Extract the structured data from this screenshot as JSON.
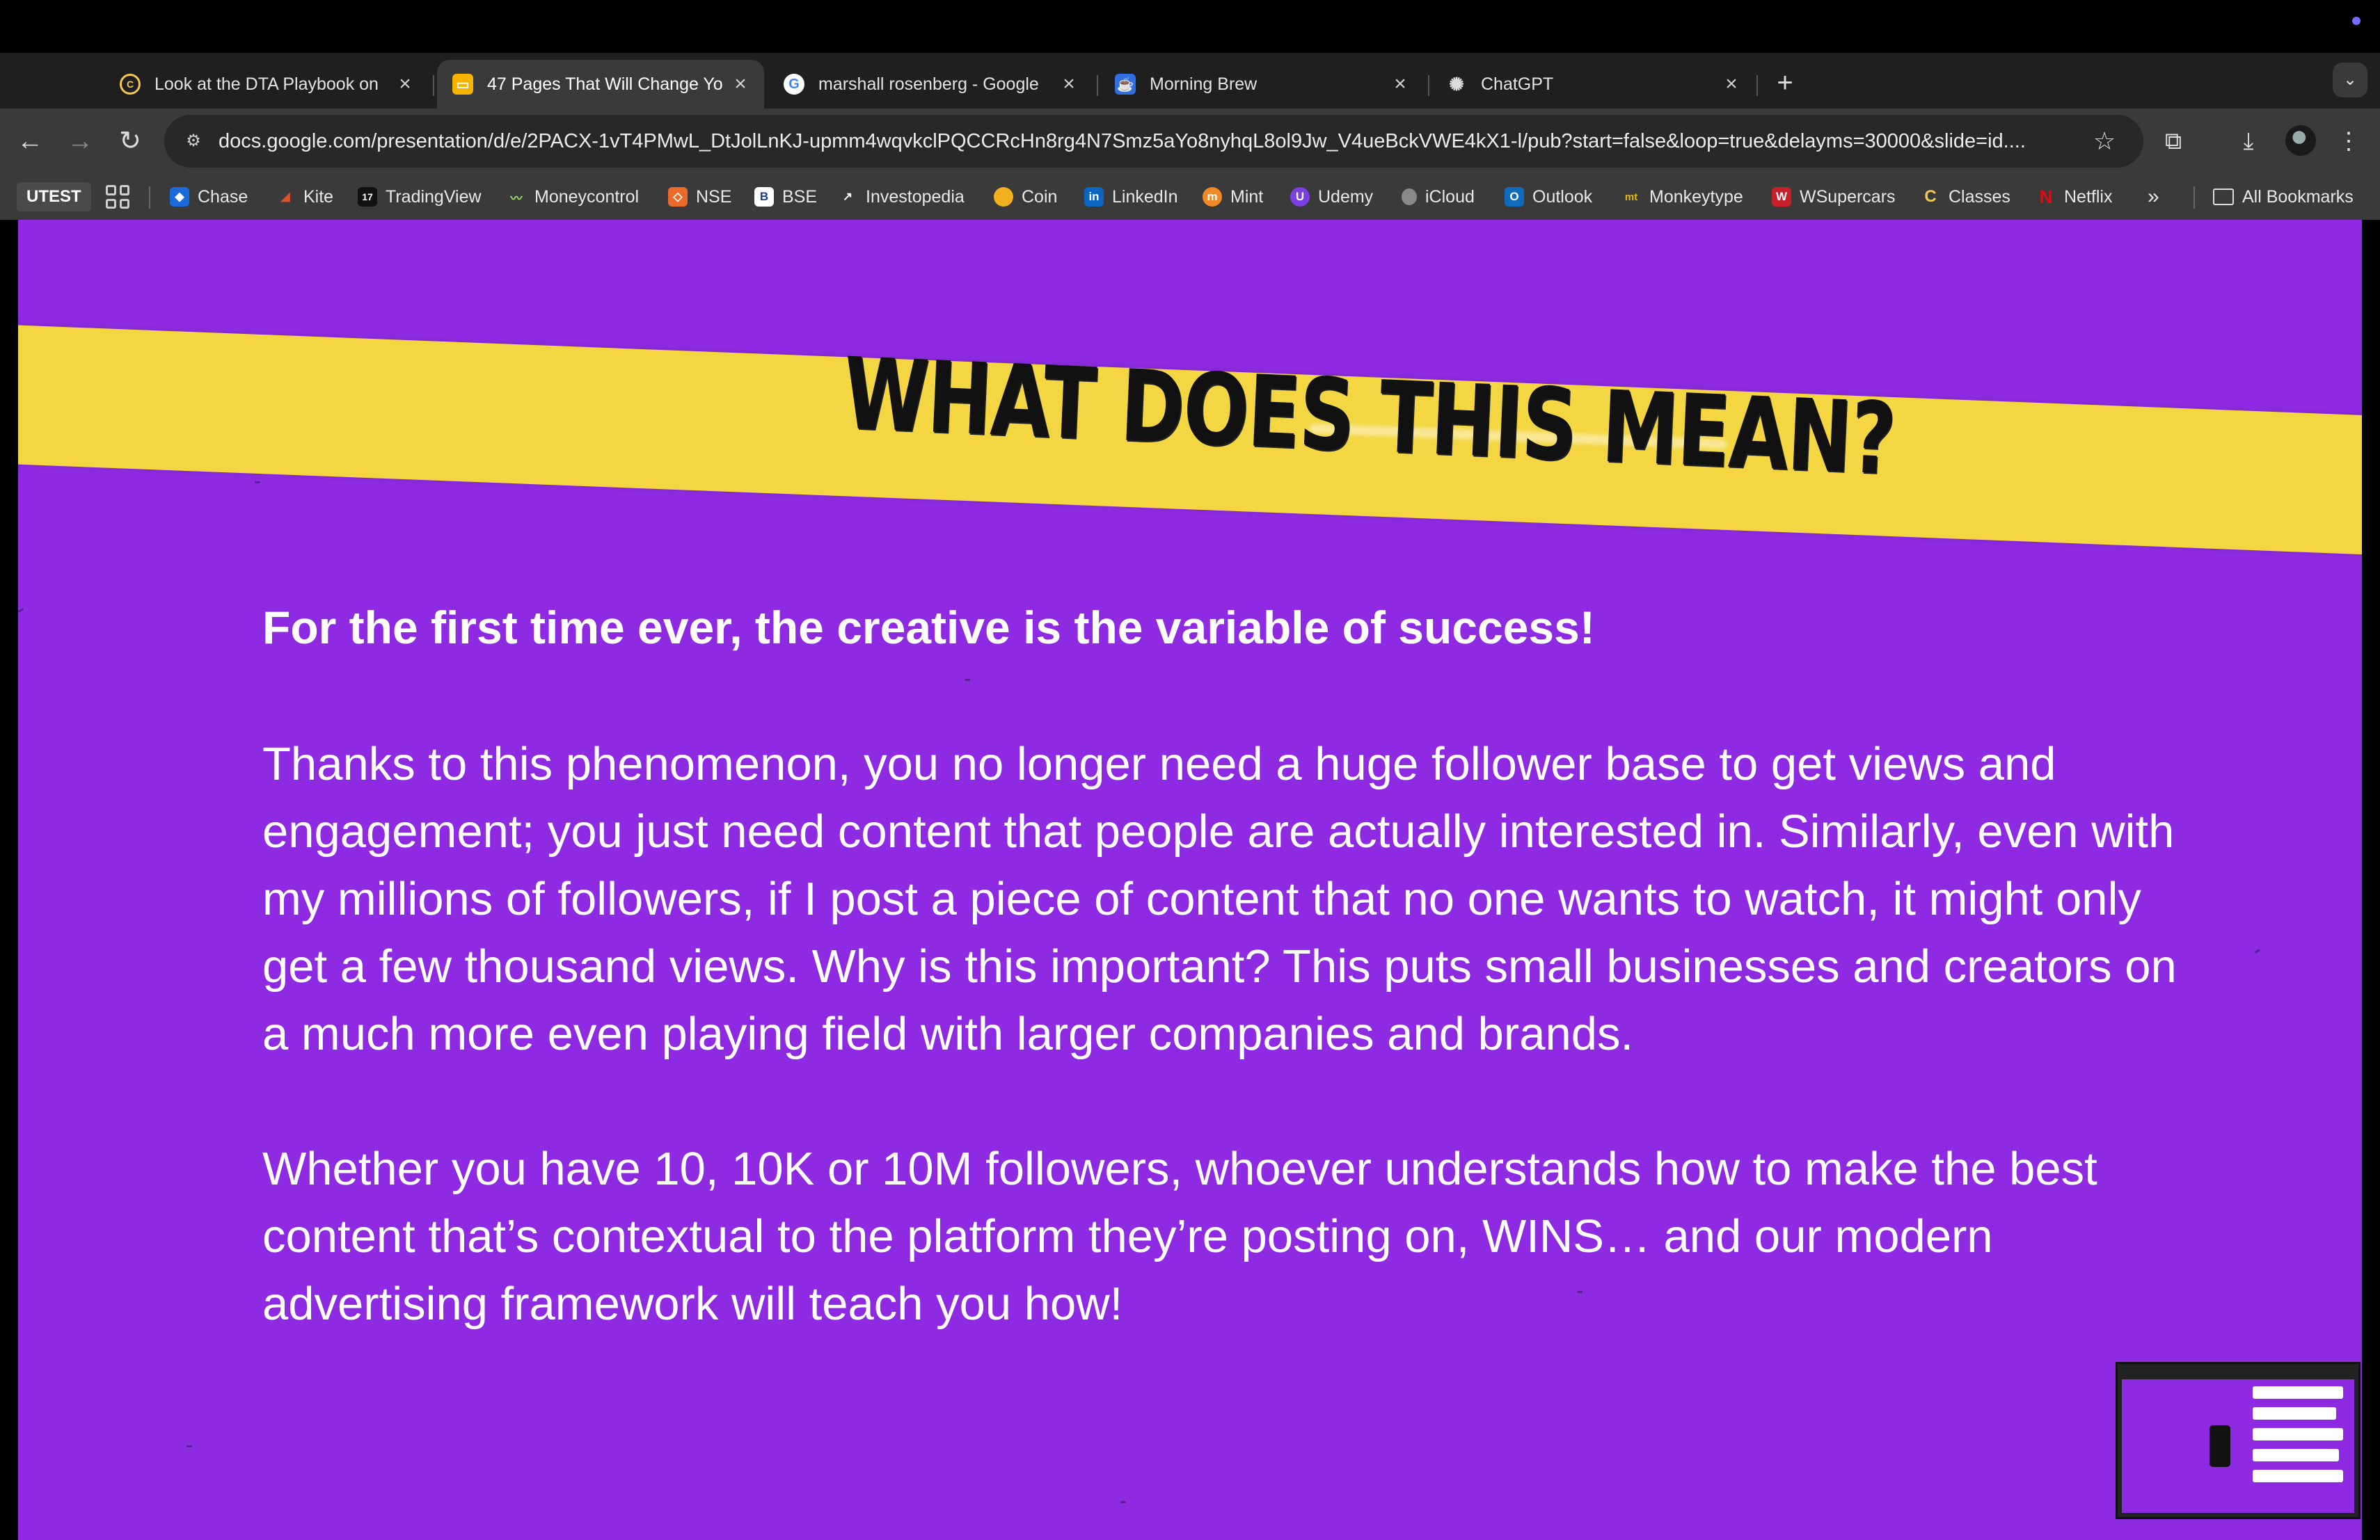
{
  "browser": {
    "tabs": [
      {
        "label": "Look at the DTA Playbook on",
        "icon": "classes-c-icon",
        "active": false
      },
      {
        "label": "47 Pages That Will Change Yo",
        "icon": "google-slides-icon",
        "active": true
      },
      {
        "label": "marshall rosenberg - Google",
        "icon": "google-icon",
        "active": false
      },
      {
        "label": "Morning Brew",
        "icon": "morning-brew-icon",
        "active": false
      },
      {
        "label": "ChatGPT",
        "icon": "chatgpt-icon",
        "active": false
      }
    ],
    "new_tab_symbol": "+",
    "tab_menu_symbol": "⌄",
    "address_bar": {
      "url": "docs.google.com/presentation/d/e/2PACX-1vT4PMwL_DtJolLnKJ-upmm4wqvkclPQCCRcHn8rg4N7Smz5aYo8nyhqL8ol9Jw_V4ueBckVWE4kX1-l/pub?start=false&loop=true&delayms=30000&slide=id...."
    },
    "nav": {
      "back": "←",
      "forward": "→",
      "reload": "↻"
    },
    "bookmarks": [
      {
        "label": "Chase",
        "color": "#1a6ad9",
        "glyph": "◆"
      },
      {
        "label": "Kite",
        "color": "#e0502b",
        "glyph": "◢"
      },
      {
        "label": "TradingView",
        "color": "#111111",
        "glyph": "17"
      },
      {
        "label": "Moneycontrol",
        "color": "#3a3a3a",
        "glyph": "⌇"
      },
      {
        "label": "NSE",
        "color": "#e96a2a",
        "glyph": "◇"
      },
      {
        "label": "BSE",
        "color": "#ffffff",
        "glyph": "B"
      },
      {
        "label": "Investopedia",
        "color": "#3a3a3a",
        "glyph": "↗"
      },
      {
        "label": "Coin",
        "color": "#f2b01e",
        "glyph": "●"
      },
      {
        "label": "LinkedIn",
        "color": "#0a66c2",
        "glyph": "in"
      },
      {
        "label": "Mint",
        "color": "#f08a24",
        "glyph": "m"
      },
      {
        "label": "Udemy",
        "color": "#7b3fe4",
        "glyph": "U"
      },
      {
        "label": "iCloud",
        "color": "#3a3a3a",
        "glyph": ""
      },
      {
        "label": "Outlook",
        "color": "#0f6cbd",
        "glyph": "O"
      },
      {
        "label": "Monkeytype",
        "color": "#3a3a3a",
        "glyph": "mt"
      },
      {
        "label": "WSupercars",
        "color": "#c8202a",
        "glyph": "W"
      },
      {
        "label": "Classes",
        "color": "#3a3a3a",
        "glyph": "C"
      },
      {
        "label": "Netflix",
        "color": "#3a3a3a",
        "glyph": "N"
      }
    ],
    "bookmarks_overflow": "»",
    "all_bookmarks": "All Bookmarks",
    "utest": "UTEST"
  },
  "slide": {
    "title": "WHAT DOES THIS MEAN?",
    "headline": "For the first time ever, the creative is the variable of success!",
    "paragraph_1": "Thanks to this phenomenon, you no longer need a huge follower base to get views and engagement; you just need content that people are actually interested in. Similarly, even with my millions of followers, if I post a piece of content that no one wants to watch, it might only get a few thousand views. Why is this important? This puts small businesses and creators on a much more even playing field with larger companies and brands.",
    "paragraph_2": "Whether you have 10, 10K or 10M followers, whoever understands how to make the best content that’s contextual to the platform they’re posting on, WINS… and our modern advertising framework will teach you how!",
    "background_color": "#8e2be2",
    "banner_color": "#f3d641"
  }
}
